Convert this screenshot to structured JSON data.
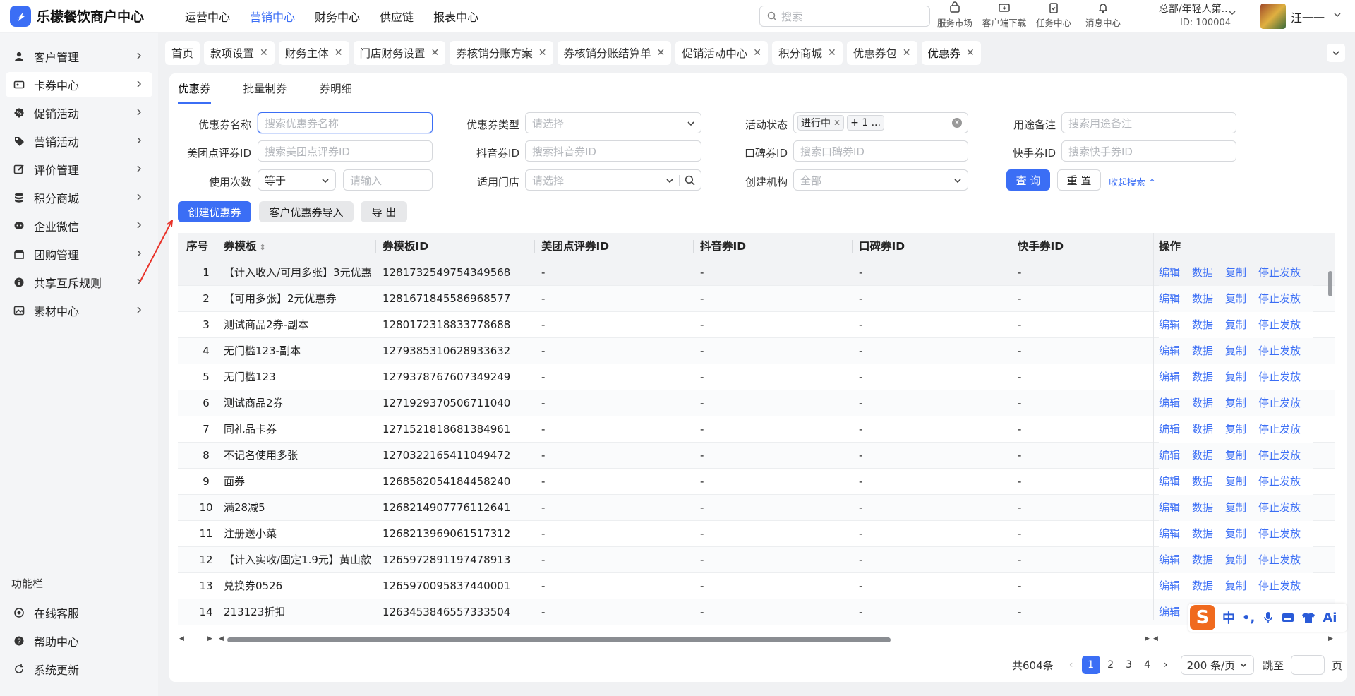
{
  "app": {
    "logo_text": "乐檬餐饮商户中心"
  },
  "topnav": [
    "运营中心",
    "营销中心",
    "财务中心",
    "供应链",
    "报表中心"
  ],
  "search": {
    "placeholder": "搜索"
  },
  "top_icons": [
    "服务市场",
    "客户端下载",
    "任务中心",
    "消息中心"
  ],
  "org": {
    "name": "总部/年轻人第...",
    "id": "ID: 100004"
  },
  "user": {
    "name": "汪一一"
  },
  "sidebar": {
    "items": [
      "客户管理",
      "卡券中心",
      "促销活动",
      "营销活动",
      "评价管理",
      "积分商城",
      "企业微信",
      "团购管理",
      "共享互斥规则",
      "素材中心"
    ],
    "func_title": "功能栏",
    "func_items": [
      "在线客服",
      "帮助中心",
      "系统更新"
    ]
  },
  "tabs": [
    "首页",
    "款项设置",
    "财务主体",
    "门店财务设置",
    "券核销分账方案",
    "券核销分账结算单",
    "促销活动中心",
    "积分商城",
    "优惠券包",
    "优惠券"
  ],
  "subtabs": [
    "优惠券",
    "批量制券",
    "券明细"
  ],
  "filters": {
    "coupon_name_label": "优惠券名称",
    "coupon_name_ph": "搜索优惠券名称",
    "coupon_type_label": "优惠券类型",
    "coupon_type_ph": "请选择",
    "activity_status_label": "活动状态",
    "activity_status_tag": "进行中",
    "activity_status_more": "+ 1 ...",
    "remark_label": "用途备注",
    "remark_ph": "搜索用途备注",
    "meituan_label": "美团点评券ID",
    "meituan_ph": "搜索美团点评券ID",
    "douyin_label": "抖音券ID",
    "douyin_ph": "搜索抖音券ID",
    "koubei_label": "口碑券ID",
    "koubei_ph": "搜索口碑券ID",
    "kuaishou_label": "快手券ID",
    "kuaishou_ph": "搜索快手券ID",
    "usage_label": "使用次数",
    "usage_op": "等于",
    "usage_ph": "请输入",
    "store_label": "适用门店",
    "store_ph": "请选择",
    "org_label": "创建机构",
    "org_value": "全部",
    "query": "查 询",
    "reset": "重 置",
    "collapse": "收起搜索"
  },
  "actions": {
    "create": "创建优惠券",
    "import": "客户优惠券导入",
    "export": "导 出"
  },
  "table": {
    "headers": [
      "序号",
      "券模板",
      "券模板ID",
      "美团点评券ID",
      "抖音券ID",
      "口碑券ID",
      "快手券ID",
      "操作"
    ],
    "ops": [
      "编辑",
      "数据",
      "复制",
      "停止发放"
    ],
    "rows": [
      [
        "1",
        "【计入收入/可用多张】3元优惠",
        "1281732549754349568",
        "-",
        "-",
        "-",
        "-"
      ],
      [
        "2",
        "【可用多张】2元优惠券",
        "1281671845586968577",
        "-",
        "-",
        "-",
        "-"
      ],
      [
        "3",
        "测试商品2券-副本",
        "1280172318833778688",
        "-",
        "-",
        "-",
        "-"
      ],
      [
        "4",
        "无门槛123-副本",
        "1279385310628933632",
        "-",
        "-",
        "-",
        "-"
      ],
      [
        "5",
        "无门槛123",
        "1279378767607349249",
        "-",
        "-",
        "-",
        "-"
      ],
      [
        "6",
        "测试商品2券",
        "1271929370506711040",
        "-",
        "-",
        "-",
        "-"
      ],
      [
        "7",
        "同礼品卡券",
        "1271521818681384961",
        "-",
        "-",
        "-",
        "-"
      ],
      [
        "8",
        "不记名使用多张",
        "1270322165411049472",
        "-",
        "-",
        "-",
        "-"
      ],
      [
        "9",
        "面券",
        "1268582054184458240",
        "-",
        "-",
        "-",
        "-"
      ],
      [
        "10",
        "满28减5",
        "1268214907776112641",
        "-",
        "-",
        "-",
        "-"
      ],
      [
        "11",
        "注册送小菜",
        "1268213969061517312",
        "-",
        "-",
        "-",
        "-"
      ],
      [
        "12",
        "【计入实收/固定1.9元】黄山歙",
        "1265972891197478913",
        "-",
        "-",
        "-",
        "-"
      ],
      [
        "13",
        "兑换券0526",
        "1265970095837440001",
        "-",
        "-",
        "-",
        "-"
      ],
      [
        "14",
        "213123折扣",
        "1263453846557333504",
        "-",
        "-",
        "-",
        "-"
      ]
    ]
  },
  "pager": {
    "total": "共604条",
    "pages": [
      "1",
      "2",
      "3",
      "4"
    ],
    "size": "200 条/页",
    "jump": "跳至",
    "page_unit": "页"
  },
  "ime": {
    "items": [
      "中",
      "•,"
    ]
  },
  "colors": {
    "primary": "#3b6ef5",
    "sidebar_bg": "#f4f5f7",
    "page_bg": "#f0f1f3"
  }
}
